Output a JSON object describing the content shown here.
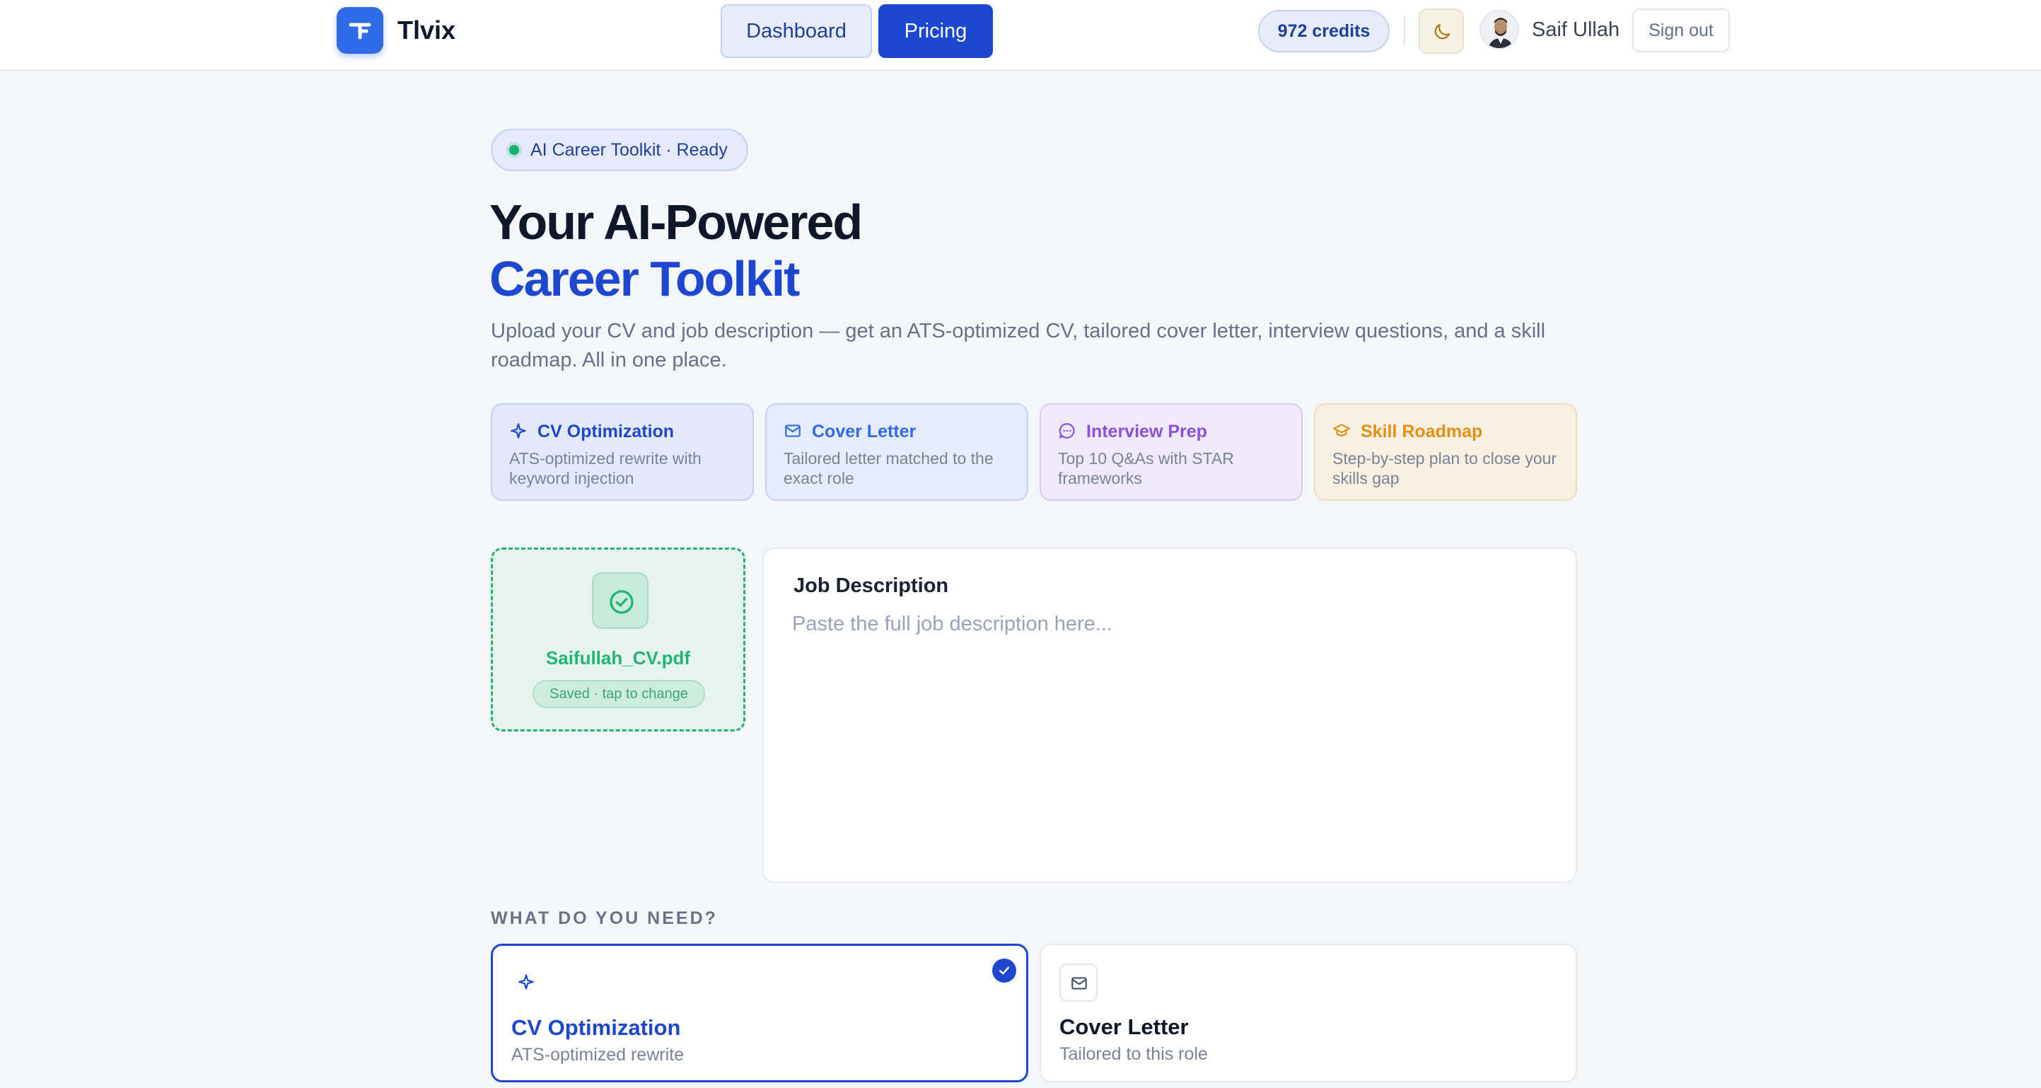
{
  "header": {
    "brand": "Tlvix",
    "nav": {
      "dashboard": "Dashboard",
      "pricing": "Pricing"
    },
    "credits": "972 credits",
    "user_name": "Saif Ullah",
    "sign_out": "Sign out"
  },
  "hero": {
    "status": "AI Career Toolkit · Ready",
    "title_line1": "Your AI-Powered",
    "title_line2": "Career Toolkit",
    "lead": "Upload your CV and job description — get an ATS-optimized CV, tailored cover letter, interview questions, and a skill roadmap. All in one place."
  },
  "features": [
    {
      "title": "CV Optimization",
      "desc": "ATS-optimized rewrite with keyword injection",
      "icon": "sparkle-icon"
    },
    {
      "title": "Cover Letter",
      "desc": "Tailored letter matched to the exact role",
      "icon": "mail-icon"
    },
    {
      "title": "Interview Prep",
      "desc": "Top 10 Q&As with STAR frameworks",
      "icon": "chat-bubble-icon"
    },
    {
      "title": "Skill Roadmap",
      "desc": "Step-by-step plan to close your skills gap",
      "icon": "graduation-cap-icon"
    }
  ],
  "upload": {
    "file_name": "Saifullah_CV.pdf",
    "status": "Saved · tap to change"
  },
  "job_description": {
    "label": "Job Description",
    "placeholder": "Paste the full job description here...",
    "value": ""
  },
  "needs": {
    "label": "WHAT DO YOU NEED?",
    "options": [
      {
        "title": "CV Optimization",
        "desc": "ATS-optimized rewrite",
        "selected": true
      },
      {
        "title": "Cover Letter",
        "desc": "Tailored to this role",
        "selected": false
      }
    ]
  },
  "colors": {
    "primary": "#1d47d1",
    "logo": "#2f6be8",
    "success": "#22b573",
    "interview": "#8a4fe0",
    "roadmap": "#e58f12"
  }
}
